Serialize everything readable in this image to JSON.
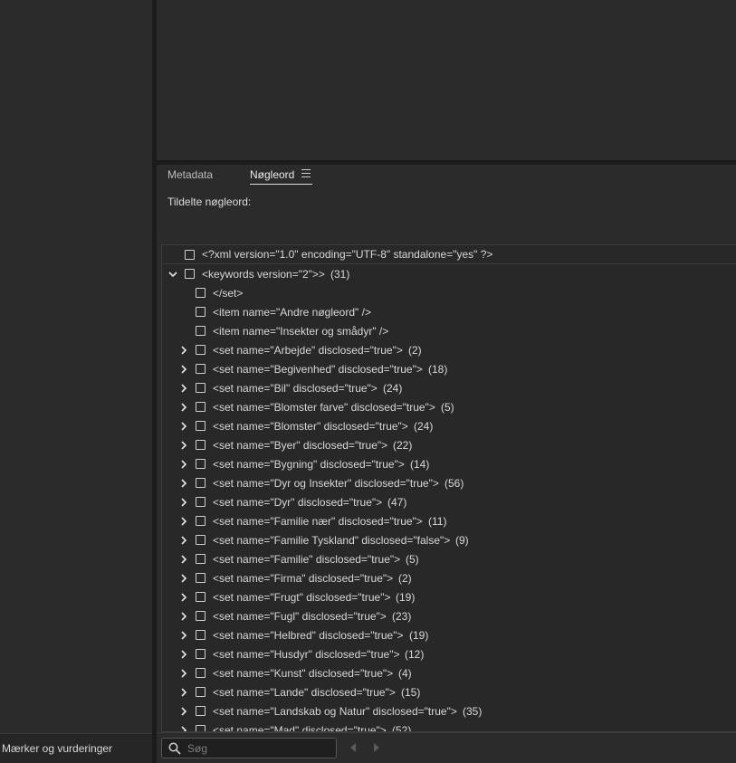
{
  "left_status": {
    "text": "g Ctrl til Mærker og vurderinger"
  },
  "tabs": [
    {
      "label": "Metadata"
    },
    {
      "label": "Nøgleord"
    }
  ],
  "assigned_label": "Tildelte nøgleord:",
  "tree": {
    "rows": [
      {
        "text": "<?xml version=\"1.0\" encoding=\"UTF-8\" standalone=\"yes\" ?>",
        "count": "",
        "level": 0,
        "chevron": "none"
      },
      {
        "text": "<keywords version=\"2\">>",
        "count": "(31)",
        "level": 0,
        "chevron": "down"
      },
      {
        "text": "</set>",
        "count": "",
        "level": 1,
        "chevron": "none"
      },
      {
        "text": "<item name=\"Andre nøgleord\" />",
        "count": "",
        "level": 1,
        "chevron": "none"
      },
      {
        "text": "<item name=\"Insekter og smådyr\" />",
        "count": "",
        "level": 1,
        "chevron": "none"
      },
      {
        "text": "<set name=\"Arbejde\" disclosed=\"true\">",
        "count": "(2)",
        "level": 1,
        "chevron": "right"
      },
      {
        "text": "<set name=\"Begivenhed\" disclosed=\"true\">",
        "count": "(18)",
        "level": 1,
        "chevron": "right"
      },
      {
        "text": "<set name=\"Bil\" disclosed=\"true\">",
        "count": "(24)",
        "level": 1,
        "chevron": "right"
      },
      {
        "text": "<set name=\"Blomster farve\" disclosed=\"true\">",
        "count": "(5)",
        "level": 1,
        "chevron": "right"
      },
      {
        "text": "<set name=\"Blomster\" disclosed=\"true\">",
        "count": "(24)",
        "level": 1,
        "chevron": "right"
      },
      {
        "text": "<set name=\"Byer\" disclosed=\"true\">",
        "count": "(22)",
        "level": 1,
        "chevron": "right"
      },
      {
        "text": "<set name=\"Bygning\" disclosed=\"true\">",
        "count": "(14)",
        "level": 1,
        "chevron": "right"
      },
      {
        "text": "<set name=\"Dyr og Insekter\" disclosed=\"true\">",
        "count": "(56)",
        "level": 1,
        "chevron": "right"
      },
      {
        "text": "<set name=\"Dyr\" disclosed=\"true\">",
        "count": "(47)",
        "level": 1,
        "chevron": "right"
      },
      {
        "text": "<set name=\"Familie nær\" disclosed=\"true\">",
        "count": "(11)",
        "level": 1,
        "chevron": "right"
      },
      {
        "text": "<set name=\"Familie Tyskland\" disclosed=\"false\">",
        "count": "(9)",
        "level": 1,
        "chevron": "right"
      },
      {
        "text": "<set name=\"Familie\" disclosed=\"true\">",
        "count": "(5)",
        "level": 1,
        "chevron": "right"
      },
      {
        "text": "<set name=\"Firma\" disclosed=\"true\">",
        "count": "(2)",
        "level": 1,
        "chevron": "right"
      },
      {
        "text": "<set name=\"Frugt\" disclosed=\"true\">",
        "count": "(19)",
        "level": 1,
        "chevron": "right"
      },
      {
        "text": "<set name=\"Fugl\" disclosed=\"true\">",
        "count": "(23)",
        "level": 1,
        "chevron": "right"
      },
      {
        "text": "<set name=\"Helbred\" disclosed=\"true\">",
        "count": "(19)",
        "level": 1,
        "chevron": "right"
      },
      {
        "text": "<set name=\"Husdyr\" disclosed=\"true\">",
        "count": "(12)",
        "level": 1,
        "chevron": "right"
      },
      {
        "text": "<set name=\"Kunst\" disclosed=\"true\">",
        "count": "(4)",
        "level": 1,
        "chevron": "right"
      },
      {
        "text": "<set name=\"Lande\" disclosed=\"true\">",
        "count": "(15)",
        "level": 1,
        "chevron": "right"
      },
      {
        "text": "<set name=\"Landskab og Natur\" disclosed=\"true\">",
        "count": "(35)",
        "level": 1,
        "chevron": "right"
      },
      {
        "text": "<set name=\"Mad\" disclosed=\"true\">",
        "count": "(52)",
        "level": 1,
        "chevron": "right"
      }
    ]
  },
  "search": {
    "placeholder": "Søg",
    "value": ""
  },
  "icons": {
    "tab_menu": "hamburger-icon",
    "search": "search-icon",
    "prev": "triangle-left-icon",
    "next": "triangle-right-icon"
  }
}
